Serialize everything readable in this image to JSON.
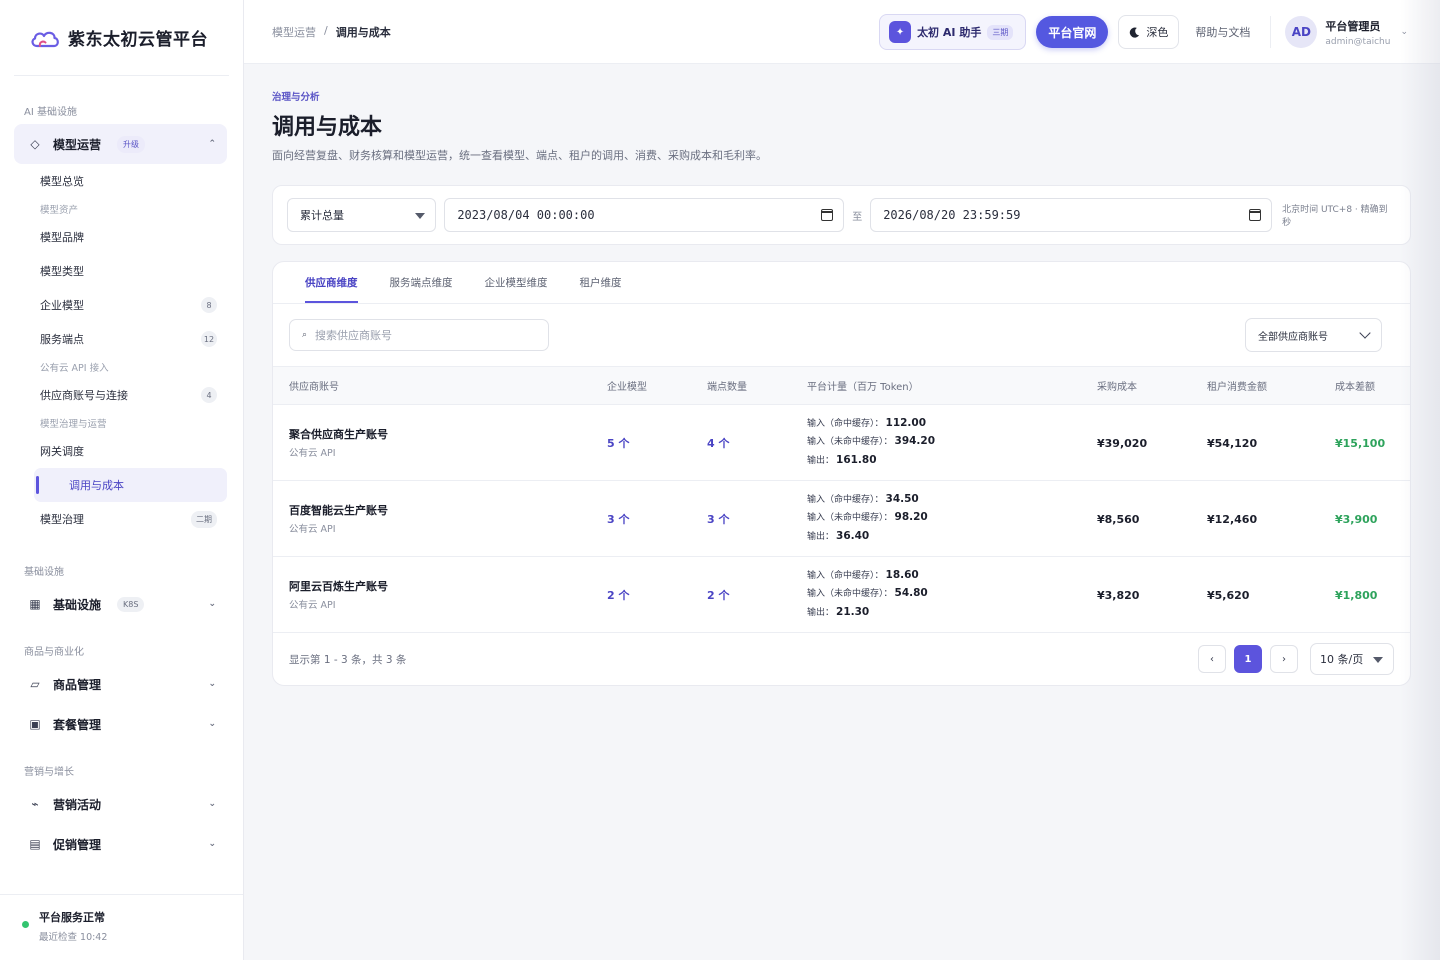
{
  "brand": {
    "name": "紫东太初云管平台",
    "accent": "#5c54dd"
  },
  "sidebar": {
    "groups": [
      {
        "label": "AI 基础设施",
        "items": [
          {
            "label": "模型运营",
            "badge": "升级",
            "icon": "diamond-icon",
            "expanded": true,
            "children": [
              {
                "type": "item",
                "label": "模型总览"
              },
              {
                "type": "label",
                "label": "模型资产"
              },
              {
                "type": "item",
                "label": "模型品牌"
              },
              {
                "type": "item",
                "label": "模型类型"
              },
              {
                "type": "item",
                "label": "企业模型",
                "count": "8"
              },
              {
                "type": "item",
                "label": "服务端点",
                "count": "12"
              },
              {
                "type": "label",
                "label": "公有云 API 接入"
              },
              {
                "type": "item",
                "label": "供应商账号与连接",
                "count": "4"
              },
              {
                "type": "label",
                "label": "模型治理与运营"
              },
              {
                "type": "item",
                "label": "网关调度"
              },
              {
                "type": "item",
                "label": "调用与成本",
                "active": true
              },
              {
                "type": "item",
                "label": "模型治理",
                "tag": "二期"
              }
            ]
          }
        ]
      },
      {
        "label": "基础设施",
        "items": [
          {
            "label": "基础设施",
            "badge": "K8S",
            "icon": "grid-icon"
          }
        ]
      },
      {
        "label": "商品与商业化",
        "items": [
          {
            "label": "商品管理",
            "icon": "tag-icon"
          },
          {
            "label": "套餐管理",
            "icon": "package-icon"
          }
        ]
      },
      {
        "label": "营销与增长",
        "items": [
          {
            "label": "营销活动",
            "icon": "trend-icon"
          },
          {
            "label": "促销管理",
            "icon": "list-icon"
          }
        ]
      }
    ],
    "footer": {
      "title": "平台服务正常",
      "subtitle": "最近检查 10:42"
    }
  },
  "header": {
    "breadcrumb": [
      "模型运营",
      "调用与成本"
    ],
    "ai_label": "太初 AI 助手",
    "ai_badge": "三期",
    "site_label": "平台官网",
    "dark_label": "深色",
    "help_label": "帮助与文档",
    "user": {
      "initials": "AD",
      "name": "平台管理员",
      "email": "admin@taichu"
    }
  },
  "page": {
    "eyebrow": "治理与分析",
    "title": "调用与成本",
    "description": "面向经营复盘、财务核算和模型运营，统一查看模型、端点、租户的调用、消费、采购成本和毛利率。"
  },
  "filter": {
    "range_mode": "累计总量",
    "start": "2023/08/04 00:00:00",
    "to_label": "至",
    "end": "2026/08/20 23:59:59",
    "tz_note": "北京时间 UTC+8 · 精确到秒"
  },
  "tabs": [
    {
      "label": "供应商维度",
      "active": true
    },
    {
      "label": "服务端点维度"
    },
    {
      "label": "企业模型维度"
    },
    {
      "label": "租户维度"
    }
  ],
  "toolbar": {
    "search_placeholder": "搜索供应商账号",
    "vendor_filter": "全部供应商账号"
  },
  "table": {
    "columns": [
      "供应商账号",
      "企业模型",
      "端点数量",
      "平台计量（百万 Token）",
      "采购成本",
      "租户消费金额",
      "成本差额"
    ],
    "meter_labels": {
      "in_hit": "输入（命中缓存）：",
      "in_miss": "输入（未命中缓存）：",
      "out": "输出："
    },
    "rows": [
      {
        "name": "聚合供应商生产账号",
        "type": "公有云 API",
        "models": "5 个",
        "endpoints": "4 个",
        "in_hit": "112.00",
        "in_miss": "394.20",
        "out": "161.80",
        "cost": "¥39,020",
        "spend": "¥54,120",
        "diff": "¥15,100"
      },
      {
        "name": "百度智能云生产账号",
        "type": "公有云 API",
        "models": "3 个",
        "endpoints": "3 个",
        "in_hit": "34.50",
        "in_miss": "98.20",
        "out": "36.40",
        "cost": "¥8,560",
        "spend": "¥12,460",
        "diff": "¥3,900"
      },
      {
        "name": "阿里云百炼生产账号",
        "type": "公有云 API",
        "models": "2 个",
        "endpoints": "2 个",
        "in_hit": "18.60",
        "in_miss": "54.80",
        "out": "21.30",
        "cost": "¥3,820",
        "spend": "¥5,620",
        "diff": "¥1,800"
      }
    ]
  },
  "pager": {
    "info": "显示第 1 - 3 条，共 3 条",
    "prev": "‹",
    "current": "1",
    "next": "›",
    "page_size": "10 条/页"
  }
}
